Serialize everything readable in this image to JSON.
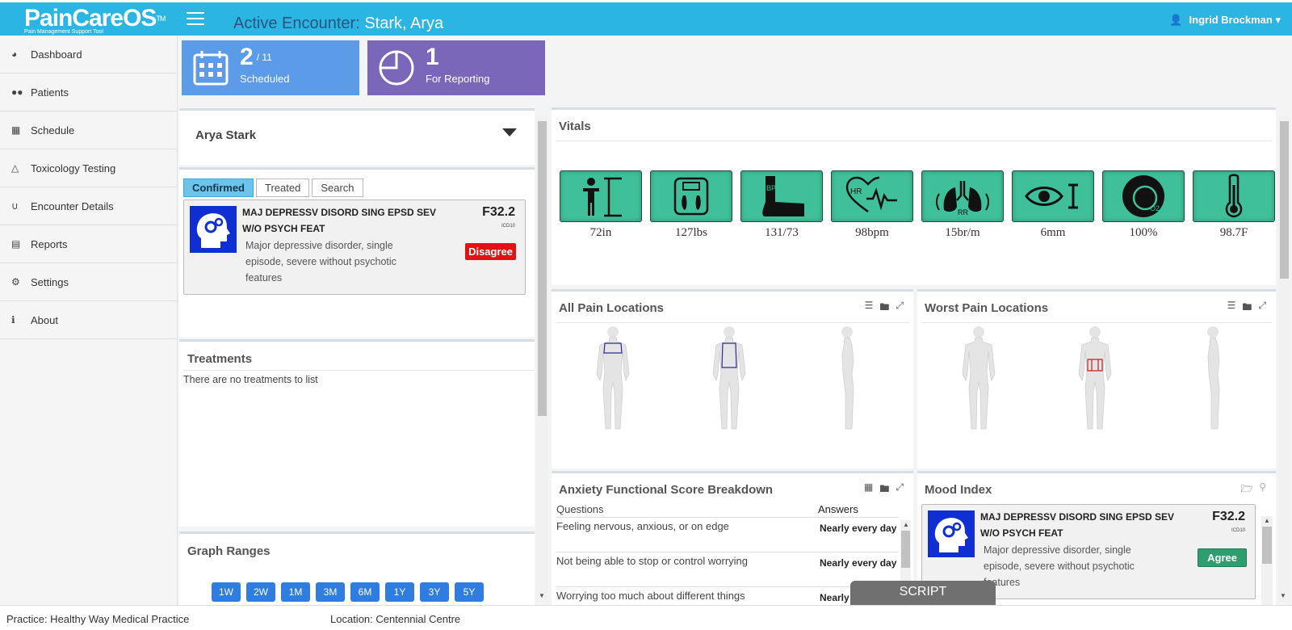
{
  "app": {
    "logo_text": "PainCareOS",
    "logo_tm": "TM",
    "logo_sub": "Pain Management Support Tool"
  },
  "header": {
    "encounter_label": "Active Encounter:",
    "patient": "Stark, Arya",
    "user": "Ingrid Brockman"
  },
  "sidebar": {
    "items": [
      {
        "label": "Dashboard",
        "icon": "dashboard-icon"
      },
      {
        "label": "Patients",
        "icon": "users-icon"
      },
      {
        "label": "Schedule",
        "icon": "calendar-icon"
      },
      {
        "label": "Toxicology Testing",
        "icon": "flask-icon"
      },
      {
        "label": "Encounter Details",
        "icon": "stethoscope-icon"
      },
      {
        "label": "Reports",
        "icon": "bar-chart-icon"
      },
      {
        "label": "Settings",
        "icon": "cogs-icon"
      },
      {
        "label": "About",
        "icon": "info-icon"
      }
    ]
  },
  "tiles": {
    "scheduled": {
      "count": "2",
      "total": "/ 11",
      "label": "Scheduled"
    },
    "reporting": {
      "count": "1",
      "label": "For Reporting"
    }
  },
  "patient_panel": {
    "name": "Arya Stark"
  },
  "dx_tabs": [
    "Confirmed",
    "Treated",
    "Search"
  ],
  "dx_card": {
    "title": "MAJ DEPRESSV DISORD SING EPSD SEV W/O PSYCH FEAT",
    "description": "Major depressive disorder, single episode, severe without psychotic features",
    "code": "F32.2",
    "code_system": "ICD10",
    "action": "Disagree"
  },
  "treatments": {
    "title": "Treatments",
    "empty": "There are no treatments to list"
  },
  "graph_ranges": {
    "title": "Graph Ranges",
    "buttons": [
      "1W",
      "2W",
      "1M",
      "3M",
      "6M",
      "1Y",
      "3Y",
      "5Y"
    ]
  },
  "vitals": {
    "title": "Vitals",
    "items": [
      {
        "icon": "height-icon",
        "value": "72in"
      },
      {
        "icon": "scale-icon",
        "value": "127lbs"
      },
      {
        "icon": "blood-pressure-icon",
        "value": "131/73",
        "badge": "BP"
      },
      {
        "icon": "heart-rate-icon",
        "value": "98bpm",
        "badge": "HR"
      },
      {
        "icon": "lungs-icon",
        "value": "15br/m",
        "badge": "RR"
      },
      {
        "icon": "eye-icon",
        "value": "6mm"
      },
      {
        "icon": "oxygen-icon",
        "value": "100%",
        "badge": "O2"
      },
      {
        "icon": "thermometer-icon",
        "value": "98.7F"
      }
    ]
  },
  "pain": {
    "all_title": "All Pain Locations",
    "worst_title": "Worst Pain Locations"
  },
  "anxiety": {
    "title": "Anxiety Functional Score Breakdown",
    "col_q": "Questions",
    "col_a": "Answers",
    "rows": [
      {
        "q": "Feeling nervous, anxious, or on edge",
        "a": "Nearly every day"
      },
      {
        "q": "Not being able to stop or control worrying",
        "a": "Nearly every day"
      },
      {
        "q": "Worrying too much about different things",
        "a": "Nearly every"
      }
    ]
  },
  "mood": {
    "title": "Mood Index",
    "card": {
      "title": "MAJ DEPRESSV DISORD SING EPSD SEV W/O PSYCH FEAT",
      "description": "Major depressive disorder, single episode, severe without psychotic features",
      "code": "F32.2",
      "code_system": "ICD10",
      "action": "Agree"
    }
  },
  "script_label": "SCRIPT",
  "footer": {
    "practice": "Practice: Healthy Way Medical Practice",
    "location": "Location: Centennial Centre"
  },
  "colors": {
    "header": "#2bb5e3",
    "tile_blue": "#5b9be8",
    "tile_purple": "#7a67b9",
    "vital_green": "#40c09a",
    "disagree_red": "#e01212",
    "agree_green": "#2f9e6e",
    "range_blue": "#2f7de0"
  }
}
